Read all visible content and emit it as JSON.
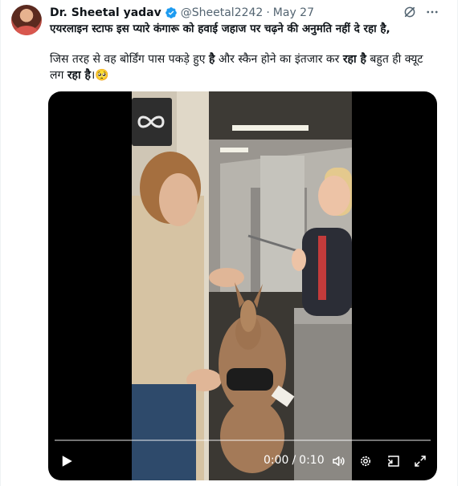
{
  "tweet": {
    "author_name": "Dr. Sheetal yadav",
    "handle": "@Sheetal2242",
    "date_separator": "·",
    "date": "May 27",
    "line1": "एयरलाइन स्टाफ इस प्यारे कंगारू को हवाई जहाज पर चढ़ने की अनुमति नहीं दे रहा है,",
    "line2_a": "जिस तरह से वह बोर्डिंग पास पकड़े हुए ",
    "line2_b": "है",
    "line2_c": " और स्कैन होने का इंतजार कर ",
    "line2_d": "रहा है",
    "line2_e": " बहुत ही क्यूट",
    "line3_a": "लग ",
    "line3_b": "रहा है",
    "line3_c": "।",
    "emoji": "🥺"
  },
  "video": {
    "current_time": "0:00",
    "time_separator": "/",
    "duration": "0:10",
    "progress": 0
  },
  "icons": {
    "verified": "verified-badge-icon",
    "grok": "grok-icon",
    "more": "more-icon",
    "play": "play-icon",
    "volume": "volume-icon",
    "settings": "settings-icon",
    "picture_in_picture": "pip-icon",
    "fullscreen": "fullscreen-icon"
  },
  "colors": {
    "verified": "#1d9bf0",
    "text": "#0f1419",
    "muted": "#536471"
  }
}
